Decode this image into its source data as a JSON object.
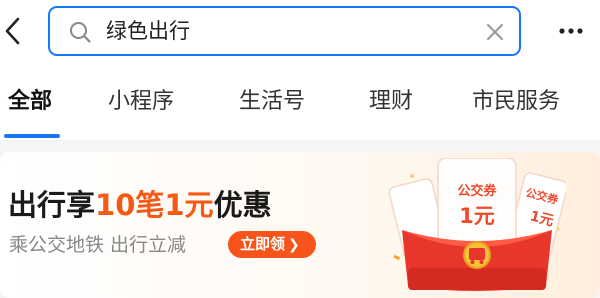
{
  "search": {
    "value": "绿色出行"
  },
  "tabs": [
    {
      "label": "全部",
      "active": true
    },
    {
      "label": "小程序",
      "active": false
    },
    {
      "label": "生活号",
      "active": false
    },
    {
      "label": "理财",
      "active": false
    },
    {
      "label": "市民服务",
      "active": false
    }
  ],
  "promo": {
    "title_pre": "出行享",
    "title_highlight": "10笔1元",
    "title_post": "优惠",
    "subtitle": "乘公交地铁 出行立减",
    "cta_label": "立即领",
    "coupon_label": "公交券",
    "coupon_value": "1元",
    "side_coupon_label": "公交券",
    "side_coupon_value": "1元"
  },
  "icons": {
    "back": "back-arrow-icon",
    "search": "search-icon",
    "clear": "close-icon",
    "more": "more-dots-icon"
  },
  "colors": {
    "accent": "#1677ff",
    "promo_highlight": "#f55a14",
    "cta_bg": "#f6541a",
    "envelope_red": "#e8362a"
  }
}
